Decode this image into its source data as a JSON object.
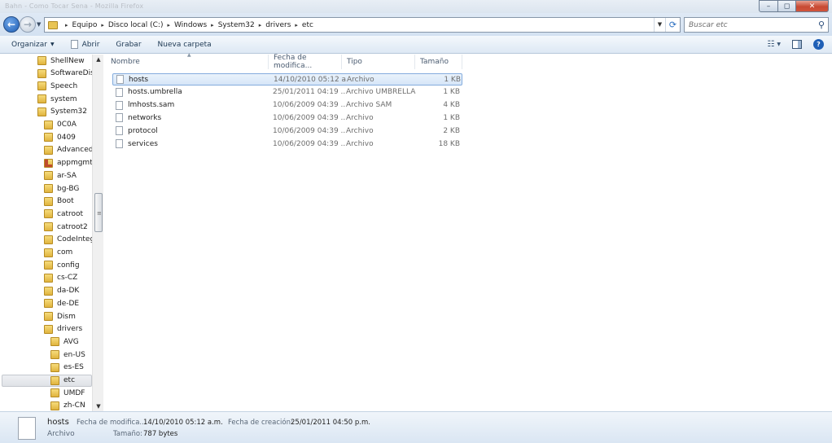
{
  "window": {
    "title": "Bahn - Como Tocar Sena - Mozilla Firefox",
    "minimize_glyph": "–",
    "maximize_glyph": "◻",
    "close_glyph": "✕"
  },
  "address": {
    "crumbs": [
      "Equipo",
      "Disco local (C:)",
      "Windows",
      "System32",
      "drivers",
      "etc"
    ],
    "separator": "▸"
  },
  "search": {
    "placeholder": "Buscar etc"
  },
  "commands": {
    "organize": "Organizar",
    "open": "Abrir",
    "burn": "Grabar",
    "new_folder": "Nueva carpeta"
  },
  "tree": {
    "items": [
      {
        "label": "ShellNew",
        "level": 1
      },
      {
        "label": "SoftwareDistri",
        "level": 1
      },
      {
        "label": "Speech",
        "level": 1
      },
      {
        "label": "system",
        "level": 1
      },
      {
        "label": "System32",
        "level": 1
      },
      {
        "label": "0C0A",
        "level": 2
      },
      {
        "label": "0409",
        "level": 2
      },
      {
        "label": "AdvancedIn",
        "level": 2
      },
      {
        "label": "appmgmt",
        "level": 2,
        "icon": "special-folder-icon"
      },
      {
        "label": "ar-SA",
        "level": 2
      },
      {
        "label": "bg-BG",
        "level": 2
      },
      {
        "label": "Boot",
        "level": 2
      },
      {
        "label": "catroot",
        "level": 2
      },
      {
        "label": "catroot2",
        "level": 2
      },
      {
        "label": "CodeIntegr",
        "level": 2
      },
      {
        "label": "com",
        "level": 2
      },
      {
        "label": "config",
        "level": 2
      },
      {
        "label": "cs-CZ",
        "level": 2
      },
      {
        "label": "da-DK",
        "level": 2
      },
      {
        "label": "de-DE",
        "level": 2
      },
      {
        "label": "Dism",
        "level": 2
      },
      {
        "label": "drivers",
        "level": 2
      },
      {
        "label": "AVG",
        "level": 3
      },
      {
        "label": "en-US",
        "level": 3
      },
      {
        "label": "es-ES",
        "level": 3
      },
      {
        "label": "etc",
        "level": 3,
        "selected": true
      },
      {
        "label": "UMDF",
        "level": 3
      },
      {
        "label": "zh-CN",
        "level": 3
      }
    ]
  },
  "columns": {
    "name": "Nombre",
    "modified": "Fecha de modifica...",
    "type": "Tipo",
    "size": "Tamaño"
  },
  "files": [
    {
      "name": "hosts",
      "modified": "14/10/2010 05:12 a....",
      "type": "Archivo",
      "size": "1 KB",
      "selected": true
    },
    {
      "name": "hosts.umbrella",
      "modified": "25/01/2011 04:19 ...",
      "type": "Archivo UMBRELLA",
      "size": "1 KB"
    },
    {
      "name": "lmhosts.sam",
      "modified": "10/06/2009 04:39 ...",
      "type": "Archivo SAM",
      "size": "4 KB"
    },
    {
      "name": "networks",
      "modified": "10/06/2009 04:39 ...",
      "type": "Archivo",
      "size": "1 KB"
    },
    {
      "name": "protocol",
      "modified": "10/06/2009 04:39 ...",
      "type": "Archivo",
      "size": "2 KB"
    },
    {
      "name": "services",
      "modified": "10/06/2009 04:39 ...",
      "type": "Archivo",
      "size": "18 KB"
    }
  ],
  "details": {
    "name": "hosts",
    "type": "Archivo",
    "modified_label": "Fecha de modifica...",
    "modified": "14/10/2010 05:12 a.m.",
    "created_label": "Fecha de creación:",
    "created": "25/01/2011 04:50 p.m.",
    "size_label": "Tamaño:",
    "size": "787 bytes"
  }
}
